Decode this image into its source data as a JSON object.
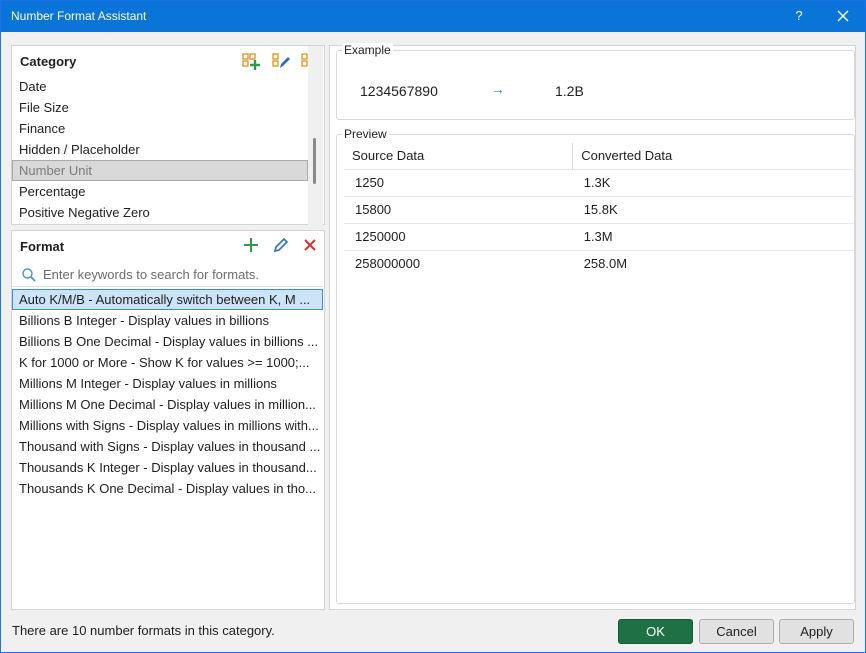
{
  "window": {
    "title": "Number Format Assistant",
    "help_label": "?"
  },
  "category": {
    "title": "Category",
    "items": [
      "Date",
      "File Size",
      "Finance",
      "Hidden / Placeholder",
      "Number Unit",
      "Percentage",
      "Positive Negative Zero"
    ],
    "selected": "Number Unit"
  },
  "format": {
    "title": "Format",
    "search_placeholder": "Enter keywords to search for formats.",
    "items": [
      "Auto K/M/B - Automatically switch between K, M ...",
      "Billions B Integer - Display values in billions",
      "Billions B One Decimal - Display values in billions ...",
      "K for 1000 or More - Show K for values >= 1000;...",
      "Millions M Integer - Display values in millions",
      "Millions M One Decimal - Display values in million...",
      "Millions with Signs - Display values in millions with...",
      "Thousand with Signs - Display values in thousand ...",
      "Thousands K Integer - Display values in thousand...",
      "Thousands K One Decimal - Display values in tho..."
    ]
  },
  "example": {
    "label": "Example",
    "source": "1234567890",
    "arrow": "→",
    "result": "1.2B"
  },
  "preview": {
    "label": "Preview",
    "headers": [
      "Source Data",
      "Converted Data"
    ],
    "rows": [
      [
        "1250",
        "1.3K"
      ],
      [
        "15800",
        "15.8K"
      ],
      [
        "1250000",
        "1.3M"
      ],
      [
        "258000000",
        "258.0M"
      ]
    ]
  },
  "status_text": "There are 10 number formats in this category.",
  "buttons": {
    "ok": "OK",
    "cancel": "Cancel",
    "apply": "Apply"
  },
  "colors": {
    "titlebar": "#0a74d9",
    "ok_button": "#1e7145",
    "add_icon": "#2e9a4e",
    "delete_icon": "#d9302c",
    "edit_icon": "#2a6fc9"
  }
}
